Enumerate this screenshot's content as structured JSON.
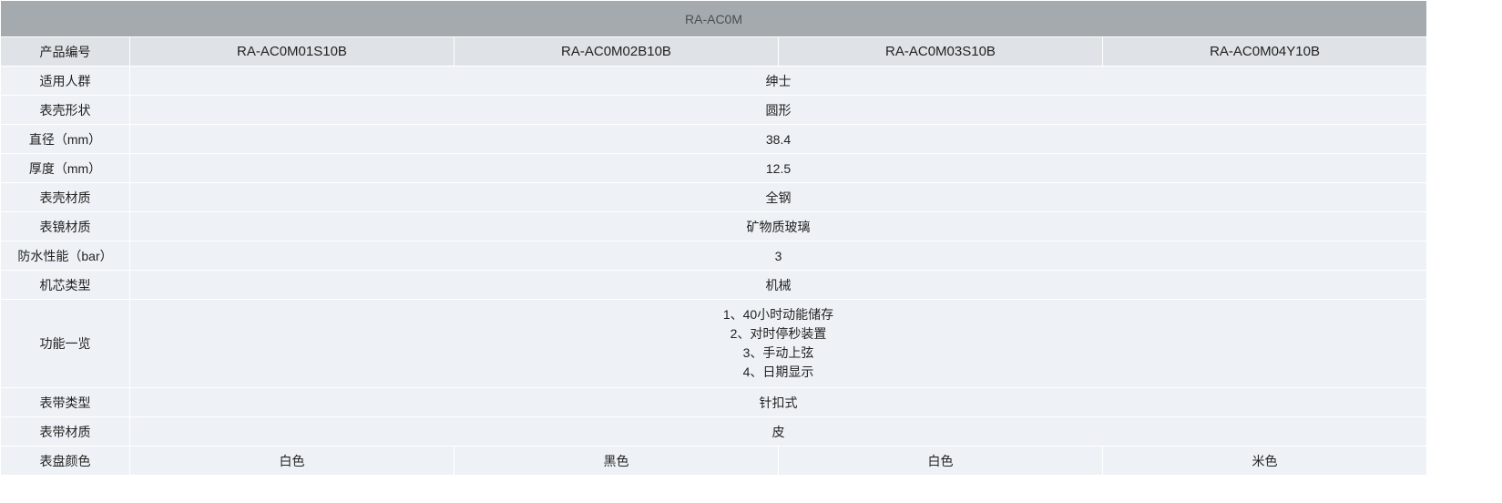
{
  "series_title": "RA-AC0M",
  "product_code_label": "产品编号",
  "models": [
    "RA-AC0M01S10B",
    "RA-AC0M02B10B",
    "RA-AC0M03S10B",
    "RA-AC0M04Y10B"
  ],
  "specs": {
    "audience": {
      "label": "适用人群",
      "value": "绅士"
    },
    "case_shape": {
      "label": "表壳形状",
      "value": "圆形"
    },
    "diameter": {
      "label": "直径（mm）",
      "value": "38.4"
    },
    "thickness": {
      "label": "厚度（mm）",
      "value": "12.5"
    },
    "case_material": {
      "label": "表壳材质",
      "value": "全钢"
    },
    "crystal_material": {
      "label": "表镜材质",
      "value": "矿物质玻璃"
    },
    "water_resistance": {
      "label": "防水性能（bar）",
      "value": "3"
    },
    "movement_type": {
      "label": "机芯类型",
      "value": "机械"
    },
    "functions": {
      "label": "功能一览",
      "lines": [
        "1、40小时动能储存",
        "2、对时停秒装置",
        "3、手动上弦",
        "4、日期显示"
      ]
    },
    "strap_type": {
      "label": "表带类型",
      "value": "针扣式"
    },
    "strap_material": {
      "label": "表带材质",
      "value": "皮"
    },
    "dial_color": {
      "label": "表盘颜色",
      "values": [
        "白色",
        "黑色",
        "白色",
        "米色"
      ]
    }
  }
}
